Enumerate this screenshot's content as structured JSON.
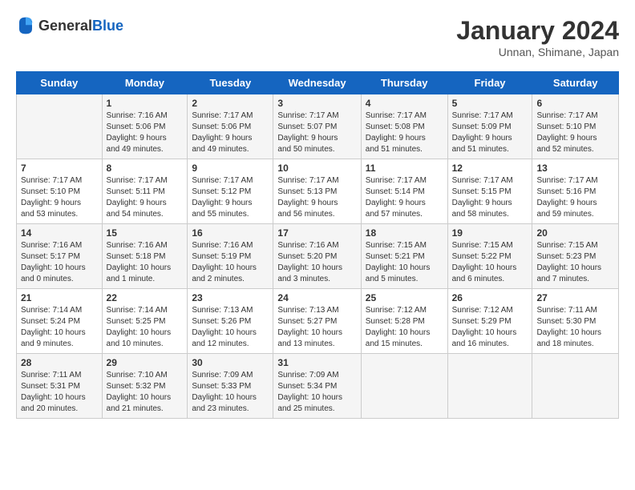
{
  "header": {
    "logo_general": "General",
    "logo_blue": "Blue",
    "title": "January 2024",
    "subtitle": "Unnan, Shimane, Japan"
  },
  "days_of_week": [
    "Sunday",
    "Monday",
    "Tuesday",
    "Wednesday",
    "Thursday",
    "Friday",
    "Saturday"
  ],
  "weeks": [
    [
      {
        "day": "",
        "info": ""
      },
      {
        "day": "1",
        "info": "Sunrise: 7:16 AM\nSunset: 5:06 PM\nDaylight: 9 hours\nand 49 minutes."
      },
      {
        "day": "2",
        "info": "Sunrise: 7:17 AM\nSunset: 5:06 PM\nDaylight: 9 hours\nand 49 minutes."
      },
      {
        "day": "3",
        "info": "Sunrise: 7:17 AM\nSunset: 5:07 PM\nDaylight: 9 hours\nand 50 minutes."
      },
      {
        "day": "4",
        "info": "Sunrise: 7:17 AM\nSunset: 5:08 PM\nDaylight: 9 hours\nand 51 minutes."
      },
      {
        "day": "5",
        "info": "Sunrise: 7:17 AM\nSunset: 5:09 PM\nDaylight: 9 hours\nand 51 minutes."
      },
      {
        "day": "6",
        "info": "Sunrise: 7:17 AM\nSunset: 5:10 PM\nDaylight: 9 hours\nand 52 minutes."
      }
    ],
    [
      {
        "day": "7",
        "info": "Sunrise: 7:17 AM\nSunset: 5:10 PM\nDaylight: 9 hours\nand 53 minutes."
      },
      {
        "day": "8",
        "info": "Sunrise: 7:17 AM\nSunset: 5:11 PM\nDaylight: 9 hours\nand 54 minutes."
      },
      {
        "day": "9",
        "info": "Sunrise: 7:17 AM\nSunset: 5:12 PM\nDaylight: 9 hours\nand 55 minutes."
      },
      {
        "day": "10",
        "info": "Sunrise: 7:17 AM\nSunset: 5:13 PM\nDaylight: 9 hours\nand 56 minutes."
      },
      {
        "day": "11",
        "info": "Sunrise: 7:17 AM\nSunset: 5:14 PM\nDaylight: 9 hours\nand 57 minutes."
      },
      {
        "day": "12",
        "info": "Sunrise: 7:17 AM\nSunset: 5:15 PM\nDaylight: 9 hours\nand 58 minutes."
      },
      {
        "day": "13",
        "info": "Sunrise: 7:17 AM\nSunset: 5:16 PM\nDaylight: 9 hours\nand 59 minutes."
      }
    ],
    [
      {
        "day": "14",
        "info": "Sunrise: 7:16 AM\nSunset: 5:17 PM\nDaylight: 10 hours\nand 0 minutes."
      },
      {
        "day": "15",
        "info": "Sunrise: 7:16 AM\nSunset: 5:18 PM\nDaylight: 10 hours\nand 1 minute."
      },
      {
        "day": "16",
        "info": "Sunrise: 7:16 AM\nSunset: 5:19 PM\nDaylight: 10 hours\nand 2 minutes."
      },
      {
        "day": "17",
        "info": "Sunrise: 7:16 AM\nSunset: 5:20 PM\nDaylight: 10 hours\nand 3 minutes."
      },
      {
        "day": "18",
        "info": "Sunrise: 7:15 AM\nSunset: 5:21 PM\nDaylight: 10 hours\nand 5 minutes."
      },
      {
        "day": "19",
        "info": "Sunrise: 7:15 AM\nSunset: 5:22 PM\nDaylight: 10 hours\nand 6 minutes."
      },
      {
        "day": "20",
        "info": "Sunrise: 7:15 AM\nSunset: 5:23 PM\nDaylight: 10 hours\nand 7 minutes."
      }
    ],
    [
      {
        "day": "21",
        "info": "Sunrise: 7:14 AM\nSunset: 5:24 PM\nDaylight: 10 hours\nand 9 minutes."
      },
      {
        "day": "22",
        "info": "Sunrise: 7:14 AM\nSunset: 5:25 PM\nDaylight: 10 hours\nand 10 minutes."
      },
      {
        "day": "23",
        "info": "Sunrise: 7:13 AM\nSunset: 5:26 PM\nDaylight: 10 hours\nand 12 minutes."
      },
      {
        "day": "24",
        "info": "Sunrise: 7:13 AM\nSunset: 5:27 PM\nDaylight: 10 hours\nand 13 minutes."
      },
      {
        "day": "25",
        "info": "Sunrise: 7:12 AM\nSunset: 5:28 PM\nDaylight: 10 hours\nand 15 minutes."
      },
      {
        "day": "26",
        "info": "Sunrise: 7:12 AM\nSunset: 5:29 PM\nDaylight: 10 hours\nand 16 minutes."
      },
      {
        "day": "27",
        "info": "Sunrise: 7:11 AM\nSunset: 5:30 PM\nDaylight: 10 hours\nand 18 minutes."
      }
    ],
    [
      {
        "day": "28",
        "info": "Sunrise: 7:11 AM\nSunset: 5:31 PM\nDaylight: 10 hours\nand 20 minutes."
      },
      {
        "day": "29",
        "info": "Sunrise: 7:10 AM\nSunset: 5:32 PM\nDaylight: 10 hours\nand 21 minutes."
      },
      {
        "day": "30",
        "info": "Sunrise: 7:09 AM\nSunset: 5:33 PM\nDaylight: 10 hours\nand 23 minutes."
      },
      {
        "day": "31",
        "info": "Sunrise: 7:09 AM\nSunset: 5:34 PM\nDaylight: 10 hours\nand 25 minutes."
      },
      {
        "day": "",
        "info": ""
      },
      {
        "day": "",
        "info": ""
      },
      {
        "day": "",
        "info": ""
      }
    ]
  ]
}
